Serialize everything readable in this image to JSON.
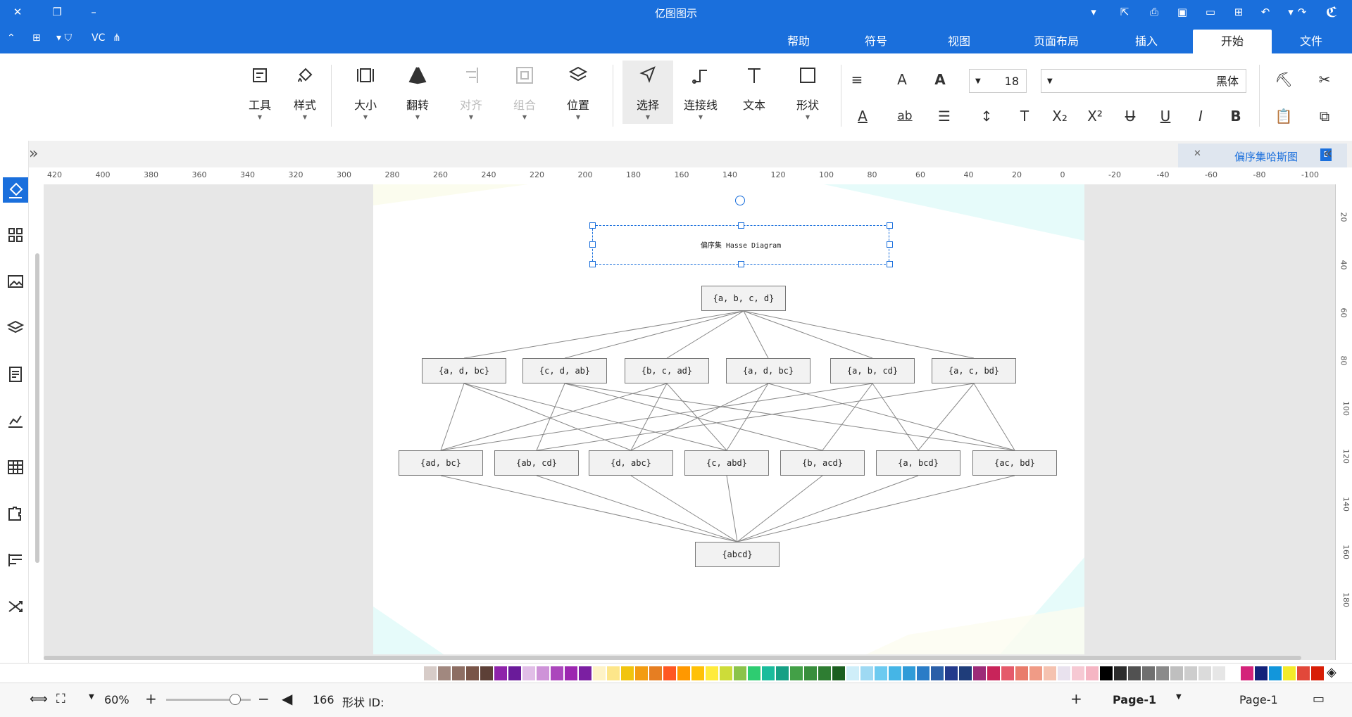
{
  "app": {
    "title": "亿图图示"
  },
  "menu": {
    "tabs": [
      "文件",
      "开始",
      "插入",
      "页面布局",
      "视图",
      "符号",
      "帮助"
    ],
    "active_tab": "开始",
    "account_label": "VC"
  },
  "ribbon": {
    "font_name": "黑体",
    "font_size": "18",
    "buttons": {
      "shape": "形状",
      "text": "文本",
      "connector": "连接线",
      "select": "选择",
      "position": "位置",
      "group": "组合",
      "align": "对齐",
      "flip": "翻转",
      "size": "大小",
      "style": "样式",
      "tools": "工具"
    }
  },
  "document": {
    "tab_title": "偏序集哈斯图"
  },
  "rulers": {
    "horizontal": [
      "-100",
      "-80",
      "-60",
      "-40",
      "-20",
      "0",
      "20",
      "40",
      "60",
      "80",
      "100",
      "120",
      "140",
      "160",
      "180",
      "200",
      "220",
      "240",
      "260",
      "280",
      "300",
      "320",
      "340",
      "360",
      "380",
      "400",
      "420"
    ],
    "vertical": [
      "20",
      "40",
      "60",
      "80",
      "100",
      "120",
      "140",
      "160",
      "180"
    ]
  },
  "diagram": {
    "title": "偏序集 Hasse Diagram",
    "top": "{a, b, c, d}",
    "level1": [
      "{a, c, bd}",
      "{a, b, cd}",
      "{a, d, bc}",
      "{b, c, ad}",
      "{c, d, ab}",
      "{a, d, bc}"
    ],
    "level2": [
      "{ac, bd}",
      "{a, bcd}",
      "{b, acd}",
      "{c, abd}",
      "{d, abc}",
      "{ab, cd}",
      "{ad, bc}"
    ],
    "bottom": "{abcd}"
  },
  "colors": {
    "brand": "#1a6fdc"
  },
  "status": {
    "page_label": "Page-1",
    "page_tab": "Page-1",
    "shape_id_label": "形状 ID:",
    "shape_id": "166",
    "zoom": "60%"
  },
  "palette": [
    "#d81e06",
    "#e2483a",
    "#f4ea2a",
    "#1296db",
    "#13227a",
    "#d4237a",
    "#ffffff",
    "#e6e6e6",
    "#dbdbdb",
    "#cdcdcd",
    "#bfbfbf",
    "#8a8a8a",
    "#707070",
    "#515151",
    "#2c2c2c",
    "#000000"
  ]
}
